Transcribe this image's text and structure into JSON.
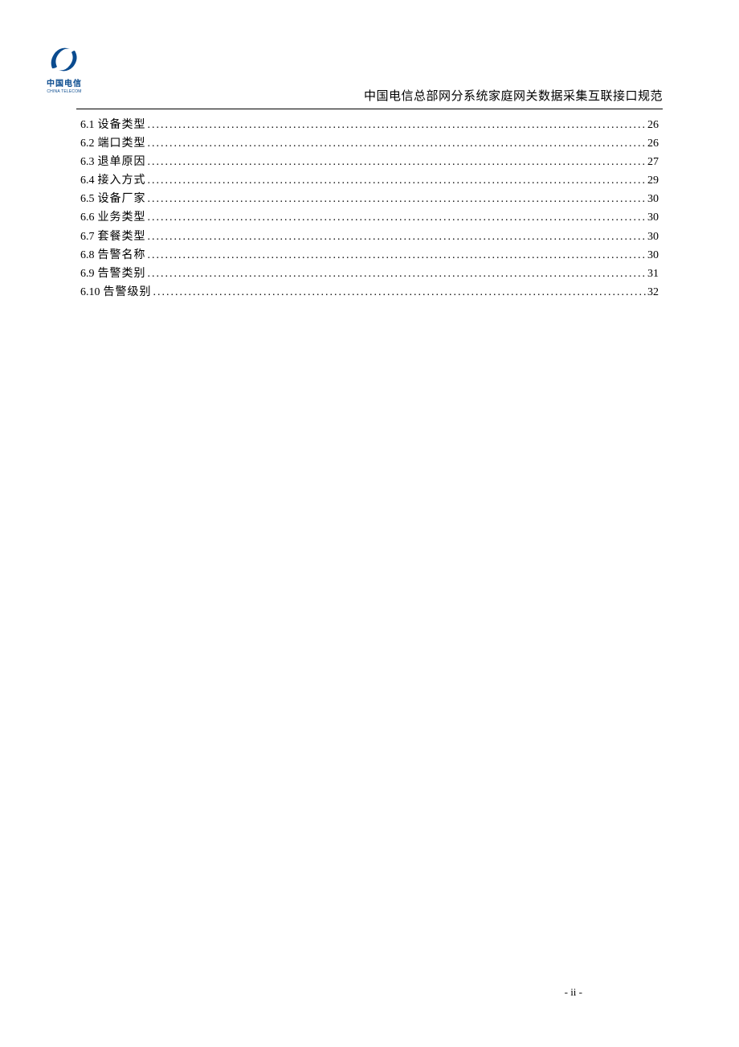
{
  "logo": {
    "brand_cn": "中国电信",
    "brand_en": "CHINA TELECOM"
  },
  "header": {
    "title": "中国电信总部网分系统家庭网关数据采集互联接口规范"
  },
  "toc": {
    "entries": [
      {
        "num": "6.1",
        "title": "设备类型",
        "page": "26"
      },
      {
        "num": "6.2",
        "title": "端口类型",
        "page": "26"
      },
      {
        "num": "6.3",
        "title": "退单原因",
        "page": "27"
      },
      {
        "num": "6.4",
        "title": "接入方式",
        "page": "29"
      },
      {
        "num": "6.5",
        "title": "设备厂家",
        "page": "30"
      },
      {
        "num": "6.6",
        "title": "业务类型",
        "page": "30"
      },
      {
        "num": "6.7",
        "title": "套餐类型",
        "page": "30"
      },
      {
        "num": "6.8",
        "title": "告警名称",
        "page": "30"
      },
      {
        "num": "6.9",
        "title": "告警类别",
        "page": "31"
      },
      {
        "num": "6.10",
        "title": "告警级别",
        "page": "32"
      }
    ]
  },
  "footer": {
    "page_number": "- ii -"
  }
}
